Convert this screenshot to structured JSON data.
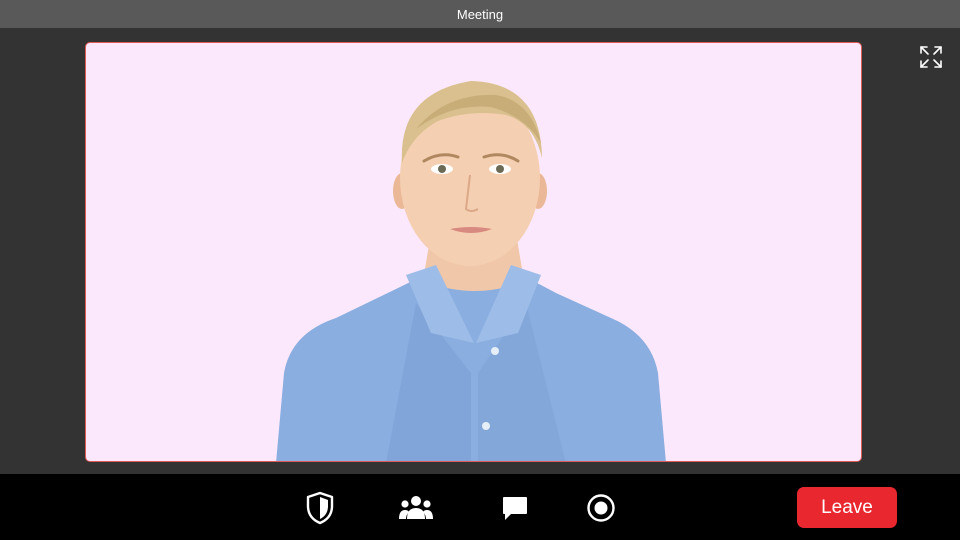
{
  "window": {
    "title": "Meeting"
  },
  "stage": {
    "tile_background": "#fce8fc",
    "tile_border": "#e05a5a",
    "fullscreen_icon": "expand-arrows-icon"
  },
  "controls": {
    "security_icon": "shield-icon",
    "participants_icon": "people-icon",
    "chat_icon": "chat-bubble-icon",
    "record_icon": "record-icon",
    "leave_label": "Leave",
    "leave_color": "#e8282e"
  },
  "colors": {
    "title_bar": "#595959",
    "background": "#333333",
    "control_bar": "#000000"
  }
}
